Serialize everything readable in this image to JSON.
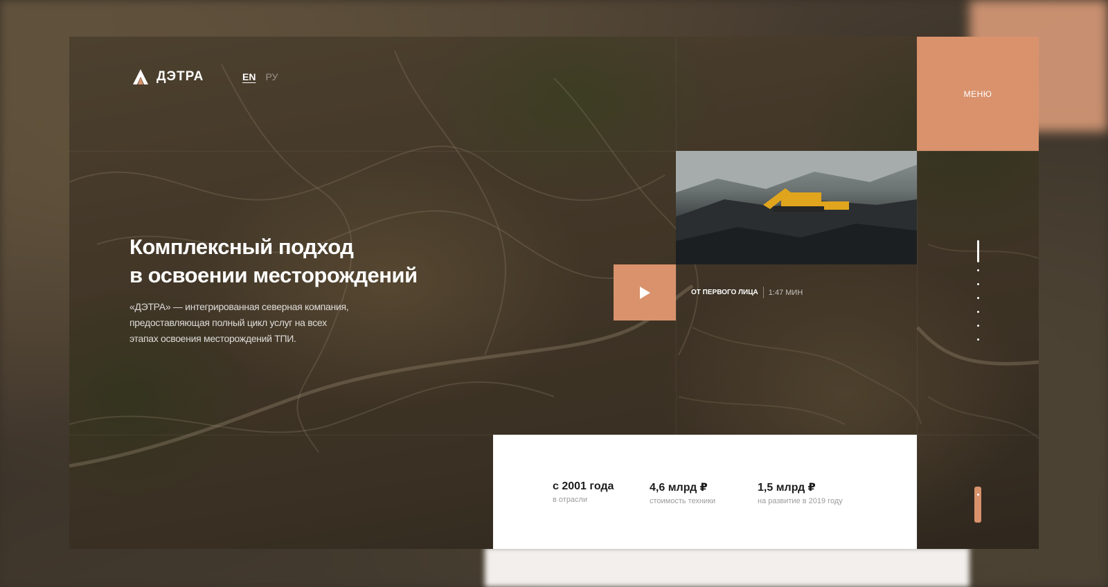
{
  "header": {
    "logo_text": "ДЭТРА",
    "languages": {
      "en": "EN",
      "ru": "РУ",
      "active": "EN"
    },
    "menu_label": "МЕНЮ"
  },
  "hero": {
    "title_line1": "Комплексный подход",
    "title_line2": "в освоении месторождений",
    "intro_line1": "«ДЭТРА» — интегрированная северная компания,",
    "intro_line2": "предоставляющая полный цикл услуг на всех",
    "intro_line3": "этапах освоения месторождений ТПИ."
  },
  "video": {
    "title": "ОТ ПЕРВОГО ЛИЦА",
    "duration": "1:47 МИН",
    "play_icon": "play-icon"
  },
  "stats": [
    {
      "value": "с 2001 года",
      "label": "в отрасли"
    },
    {
      "value": "4,6 млрд ₽",
      "label": "стоимость техники"
    },
    {
      "value": "1,5 млрд ₽",
      "label": "на развитие в 2019 году"
    }
  ],
  "pager": {
    "total_slides": 7,
    "active_index": 0
  },
  "colors": {
    "accent": "#d9926c",
    "text_light": "#ffffff",
    "stat_value": "#1d1d1d",
    "stat_label": "#9b9b9b"
  }
}
